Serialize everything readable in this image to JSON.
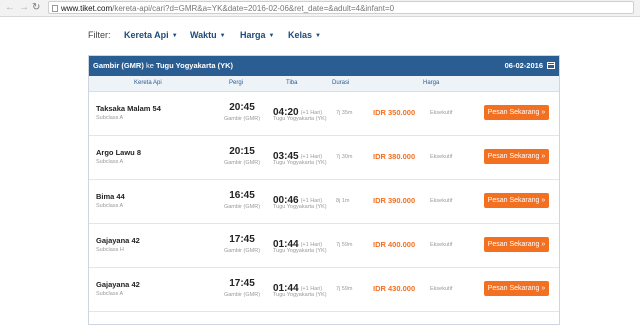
{
  "browser": {
    "url_host": "www.tiket.com",
    "url_path": "/kereta-api/cari?d=GMR&a=YK&date=2016-02-06&ret_date=&adult=4&infant=0"
  },
  "filter": {
    "label": "Filter:",
    "items": [
      "Kereta Api",
      "Waktu",
      "Harga",
      "Kelas"
    ]
  },
  "route": {
    "origin": "Gambir (GMR)",
    "connector": "ke",
    "destination": "Tugu Yogyakarta (YK)",
    "date": "06-02-2016"
  },
  "columns": {
    "train": "Kereta Api",
    "depart": "Pergi",
    "arrive": "Tiba",
    "duration": "Durasi",
    "price": "Harga"
  },
  "trains": [
    {
      "name": "Taksaka Malam 54",
      "subclass": "Subclass A",
      "dep_time": "20:45",
      "dep_station": "Gambir (GMR)",
      "arr_time": "04:20",
      "arr_plus": "(+1 Hari)",
      "arr_station": "Tugu Yogyakarta (YK)",
      "duration": "7j 35m",
      "price": "IDR 350.000",
      "class": "Eksekutif",
      "button": "Pesan Sekarang »"
    },
    {
      "name": "Argo Lawu 8",
      "subclass": "Subclass A",
      "dep_time": "20:15",
      "dep_station": "Gambir (GMR)",
      "arr_time": "03:45",
      "arr_plus": "(+1 Hari)",
      "arr_station": "Tugu Yogyakarta (YK)",
      "duration": "7j 30m",
      "price": "IDR 380.000",
      "class": "Eksekutif",
      "button": "Pesan Sekarang »"
    },
    {
      "name": "Bima 44",
      "subclass": "Subclass A",
      "dep_time": "16:45",
      "dep_station": "Gambir (GMR)",
      "arr_time": "00:46",
      "arr_plus": "(+1 Hari)",
      "arr_station": "Tugu Yogyakarta (YK)",
      "duration": "8j 1m",
      "price": "IDR 390.000",
      "class": "Eksekutif",
      "button": "Pesan Sekarang »"
    },
    {
      "name": "Gajayana 42",
      "subclass": "Subclass H",
      "dep_time": "17:45",
      "dep_station": "Gambir (GMR)",
      "arr_time": "01:44",
      "arr_plus": "(+1 Hari)",
      "arr_station": "Tugu Yogyakarta (YK)",
      "duration": "7j 59m",
      "price": "IDR 400.000",
      "class": "Eksekutif",
      "button": "Pesan Sekarang »"
    },
    {
      "name": "Gajayana 42",
      "subclass": "Subclass A",
      "dep_time": "17:45",
      "dep_station": "Gambir (GMR)",
      "arr_time": "01:44",
      "arr_plus": "(+1 Hari)",
      "arr_station": "Tugu Yogyakarta (YK)",
      "duration": "7j 59m",
      "price": "IDR 430.000",
      "class": "Eksekutif",
      "button": "Pesan Sekarang »"
    }
  ],
  "icons": {
    "back": "arrow-left-icon",
    "forward": "arrow-right-icon",
    "reload": "reload-icon",
    "caret": "caret-down-icon",
    "calendar": "calendar-icon"
  },
  "colors": {
    "header_blue": "#2a5d91",
    "accent_orange": "#f37021"
  }
}
